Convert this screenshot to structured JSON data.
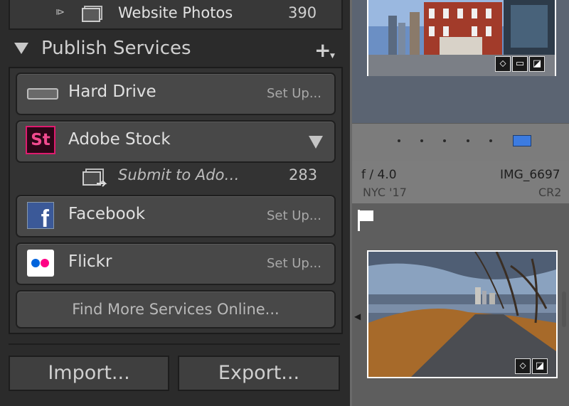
{
  "collection": {
    "name": "Website Photos",
    "count": "390",
    "arrow_glyph": "⧐"
  },
  "publish_services": {
    "title": "Publish Services",
    "add_glyph": "+",
    "add_tri_glyph": "▼",
    "services": [
      {
        "name": "Hard Drive",
        "action": "Set Up..."
      },
      {
        "name": "Adobe Stock",
        "icon_text": "St",
        "action": ""
      },
      {
        "name": "Facebook",
        "icon_text": "f",
        "action": "Set Up..."
      },
      {
        "name": "Flickr",
        "action": "Set Up..."
      }
    ],
    "sub_collection": {
      "name": "Submit to Ado…",
      "count": "283"
    },
    "find_more": "Find More Services Online..."
  },
  "buttons": {
    "import": "Import...",
    "export": "Export..."
  },
  "photo_info": {
    "aperture": "f / 4.0",
    "filename": "IMG_6697",
    "folder": "NYC '17",
    "filetype": "CR2"
  },
  "badges": {
    "tag": "⬦",
    "crop": "▭",
    "edit": "◪"
  },
  "colors": {
    "panel_bg": "#2b2b2b",
    "row_bg": "#484848",
    "grid_bg": "#6a6a6a",
    "selected_cell": "#5b6472",
    "grid_view_accent": "#3c7be0",
    "adobe_stock_pink": "#e01a6e",
    "facebook_blue": "#3b5998",
    "flickr_blue": "#0063dc",
    "flickr_pink": "#ff0084"
  },
  "icons": {
    "collection": "collection-stack-icon",
    "hard_drive": "hard-drive-icon",
    "adobe_stock": "adobe-stock-icon",
    "facebook": "facebook-icon",
    "flickr": "flickr-icon",
    "submit": "published-collection-icon",
    "flag": "flag-icon",
    "grid": "grid-view-icon"
  }
}
